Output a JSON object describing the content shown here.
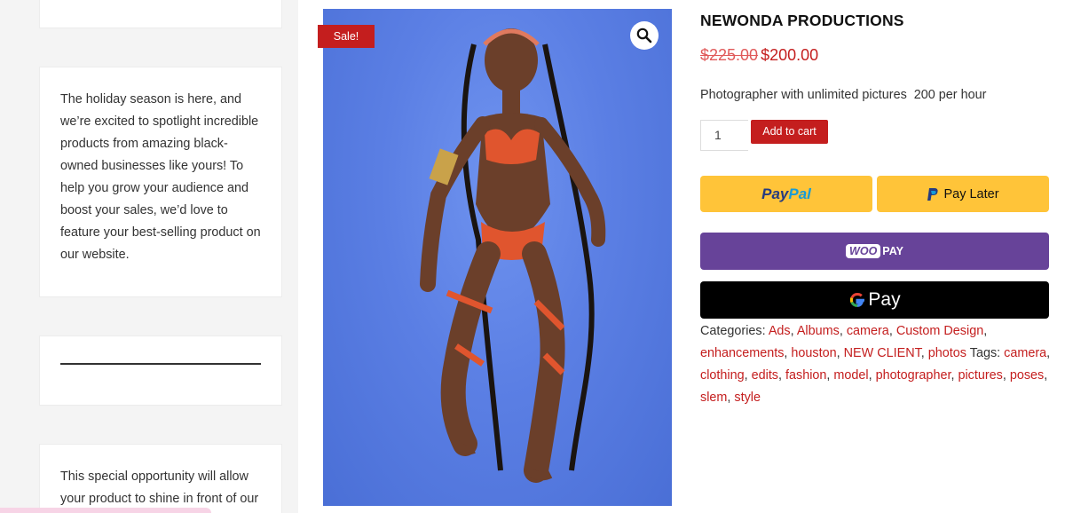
{
  "sidebar": {
    "promo_text": "The holiday season is here, and we’re excited to spotlight incredible products from amazing black-owned businesses like yours! To help you grow your audience and boost your sales, we’d love to feature your best-selling product on our website.",
    "promo_text_2": "This special opportunity will allow your product to shine in front of our"
  },
  "product": {
    "sale_badge": "Sale!",
    "title": "NEWONDA PRODUCTIONS",
    "price_old": "$225.00",
    "price_new": "$200.00",
    "description": "Photographer with unlimited pictures  200 per hour",
    "quantity": "1",
    "add_to_cart": "Add to cart",
    "image_icon": "zoom-icon"
  },
  "payments": {
    "paypal_a": "Pay",
    "paypal_b": "Pal",
    "pay_later": "Pay Later",
    "woo_a": "WOO",
    "woo_b": "PAY",
    "gpay_g": "G",
    "gpay_pay": "Pay"
  },
  "meta": {
    "categories_label": "Categories:",
    "categories": [
      "Ads",
      "Albums",
      "camera",
      "Custom Design",
      "enhancements",
      "houston",
      "NEW CLIENT",
      "photos"
    ],
    "tags_label": "Tags:",
    "tags": [
      "camera",
      "clothing",
      "edits",
      "fashion",
      "model",
      "photographer",
      "pictures",
      "poses",
      "slem",
      "style"
    ]
  },
  "colors": {
    "accent": "#c41e1e",
    "paypal_yellow": "#ffc439",
    "woopay_purple": "#674399",
    "photo_blue": "#5b7fe4"
  }
}
